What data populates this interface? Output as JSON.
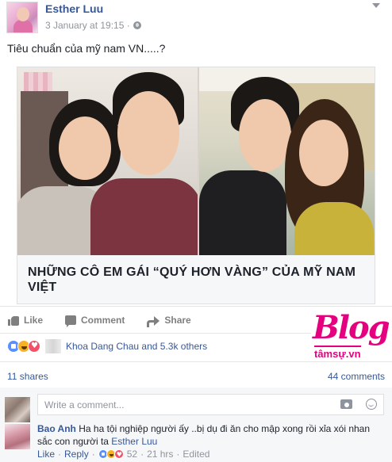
{
  "post": {
    "author": "Esther Luu",
    "timestamp": "3 January at 19:15 ·",
    "privacy_icon": "globe-icon",
    "text": "Tiêu chuẩn của mỹ nam VN.....?"
  },
  "link_preview": {
    "title": "NHỮNG CÔ EM GÁI “QUÝ HƠN VÀNG” CỦA MỸ NAM VIỆT"
  },
  "actions": {
    "like": "Like",
    "comment": "Comment",
    "share": "Share"
  },
  "watermark": {
    "word": "Blog",
    "sub": "tâmsự.vn",
    "color": "#e4007f"
  },
  "reactions": {
    "text": "Khoa Dang Chau and 5.3k others",
    "icons": [
      "like-icon",
      "haha-icon",
      "love-icon"
    ]
  },
  "stats": {
    "shares": "11 shares",
    "comments": "44 comments"
  },
  "composer": {
    "placeholder": "Write a comment..."
  },
  "comment": {
    "author": "Bao Anh",
    "text": "Ha ha tội nghiệp người ấy ..bị dụ đi ăn cho mập xong rồi xỉa xói nhan sắc con người ta",
    "tag": "Esther Luu",
    "like": "Like",
    "reply": "Reply",
    "reaction_count": "52",
    "time": "21 hrs",
    "edited": "Edited"
  },
  "colors": {
    "link": "#365899",
    "muted": "#90949c",
    "like_blue": "#5890ff",
    "love_red": "#f25268",
    "haha_yellow": "#f7b125"
  }
}
